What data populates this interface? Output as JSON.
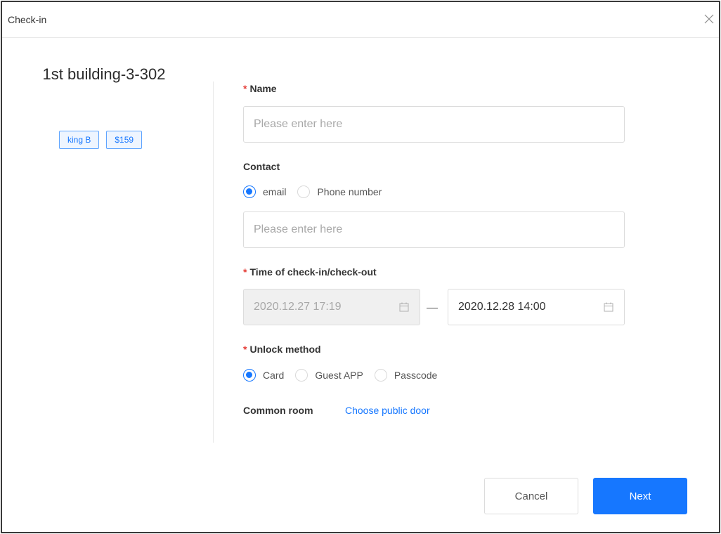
{
  "dialog": {
    "title": "Check-in"
  },
  "room": {
    "name": "1st building-3-302",
    "tags": [
      "king B",
      "$159"
    ]
  },
  "form": {
    "name": {
      "label": "Name",
      "required_mark": "*",
      "placeholder": "Please enter here",
      "value": ""
    },
    "contact": {
      "label": "Contact",
      "options": [
        "email",
        "Phone number"
      ],
      "selected": "email",
      "placeholder": "Please enter here",
      "value": ""
    },
    "time": {
      "label": "Time of check-in/check-out",
      "required_mark": "*",
      "checkin": "2020.12.27 17:19",
      "checkout": "2020.12.28 14:00"
    },
    "unlock": {
      "label": "Unlock method",
      "required_mark": "*",
      "options": [
        "Card",
        "Guest APP",
        "Passcode"
      ],
      "selected": "Card"
    },
    "common_room": {
      "label": "Common room",
      "link": "Choose public door"
    }
  },
  "footer": {
    "cancel_label": "Cancel",
    "next_label": "Next"
  },
  "colors": {
    "primary": "#1677ff",
    "required": "#e5403a",
    "tag_border": "#5fa5ff",
    "tag_bg": "#eef5ff"
  },
  "icons": {
    "close": "close-icon",
    "calendar": "calendar-icon"
  }
}
